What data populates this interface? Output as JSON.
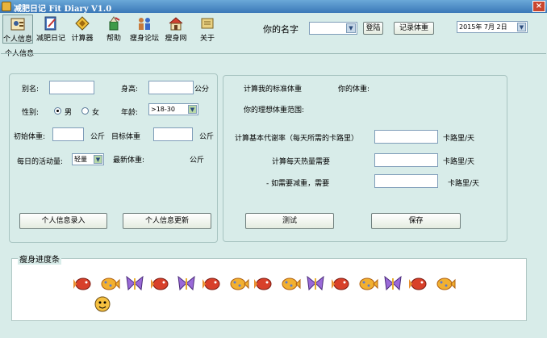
{
  "window": {
    "title": "减肥日记 Fit Diary V1.0",
    "close_label": "×"
  },
  "toolbar": [
    {
      "label": "个人信息",
      "icon": "id-card-icon"
    },
    {
      "label": "减肥日记",
      "icon": "notebook-icon"
    },
    {
      "label": "计算器",
      "icon": "calculator-icon"
    },
    {
      "label": "帮助",
      "icon": "help-icon"
    },
    {
      "label": "瘦身论坛",
      "icon": "forum-icon"
    },
    {
      "label": "瘦身网",
      "icon": "home-icon"
    },
    {
      "label": "关于",
      "icon": "about-icon"
    }
  ],
  "header": {
    "name_label": "你的名字",
    "name_value": "",
    "login_label": "登陆",
    "record_weight_label": "记录体重",
    "date_value": "2015年 7月 2日"
  },
  "section_title": "个人信息",
  "personal": {
    "alias_label": "别名:",
    "height_label": "身高:",
    "height_unit": "公分",
    "gender_label": "性别:",
    "gender_male": "男",
    "gender_female": "女",
    "age_label": "年龄:",
    "age_value": ">18-30",
    "initial_weight_label": "初始体重:",
    "initial_weight_unit": "公斤",
    "target_weight_label": "目标体重",
    "target_weight_unit": "公斤",
    "activity_label": "每日的活动量:",
    "activity_value": "轻量",
    "latest_weight_label": "最新体重:",
    "latest_weight_unit": "公斤",
    "enter_button": "个人信息录入",
    "update_button": "个人信息更新"
  },
  "calc": {
    "std_weight_label": "计算我的标准体重",
    "your_weight_label": "你的体重:",
    "ideal_range_label": "你的理想体重范围:",
    "bmr_label": "计算基本代谢率（每天所需的卡路里）",
    "bmr_unit": "卡路里/天",
    "daily_heat_label": "计算每天热量需要",
    "daily_heat_unit": "卡路里/天",
    "reduce_label": "- 如需要减重，需要",
    "reduce_unit": "卡路里/天",
    "test_button": "测试",
    "save_button": "保存"
  },
  "progress": {
    "title": "瘦身进度条"
  },
  "colors": {
    "background": "#d8ece9",
    "titlebar": "#3b78b8",
    "panel_border": "#a8c4c1"
  }
}
